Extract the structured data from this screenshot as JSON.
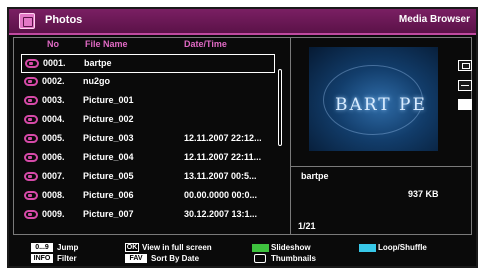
{
  "header": {
    "title": "Photos",
    "right_title": "Media Browser"
  },
  "columns": {
    "no": "No",
    "file_name": "File Name",
    "date_time": "Date/Time"
  },
  "files": [
    {
      "no": "0001.",
      "name": "bartpe",
      "date": ""
    },
    {
      "no": "0002.",
      "name": "nu2go",
      "date": ""
    },
    {
      "no": "0003.",
      "name": "Picture_001",
      "date": ""
    },
    {
      "no": "0004.",
      "name": "Picture_002",
      "date": ""
    },
    {
      "no": "0005.",
      "name": "Picture_003",
      "date": "12.11.2007 22:12..."
    },
    {
      "no": "0006.",
      "name": "Picture_004",
      "date": "12.11.2007 22:11..."
    },
    {
      "no": "0007.",
      "name": "Picture_005",
      "date": "13.11.2007 00:5..."
    },
    {
      "no": "0008.",
      "name": "Picture_006",
      "date": "00.00.0000 00:0..."
    },
    {
      "no": "0009.",
      "name": "Picture_007",
      "date": "30.12.2007 13:1..."
    }
  ],
  "preview": {
    "logo_text": "BART PE"
  },
  "info": {
    "name": "bartpe",
    "size": "937 KB",
    "count": "1/21"
  },
  "footer": {
    "jump_key": "0...9",
    "jump_label": "Jump",
    "info_key": "INFO",
    "filter_label": "Filter",
    "ok_key": "OK",
    "view_label": "View in full screen",
    "fav_key": "FAV",
    "sort_label": "Sort By Date",
    "slideshow_label": "Slideshow",
    "thumbnails_label": "Thumbnails",
    "loop_label": "Loop/Shuffle"
  },
  "colors": {
    "header_bg": "#7a1f63",
    "accent_pink": "#e06ac4",
    "green_key": "#3ec23e",
    "cyan_key": "#38c8e8"
  },
  "icons": [
    "photos-app-icon",
    "folder-icon",
    "display-mode-icon",
    "shuffle-icon",
    "fullscreen-icon",
    "thumbnails-icon"
  ]
}
